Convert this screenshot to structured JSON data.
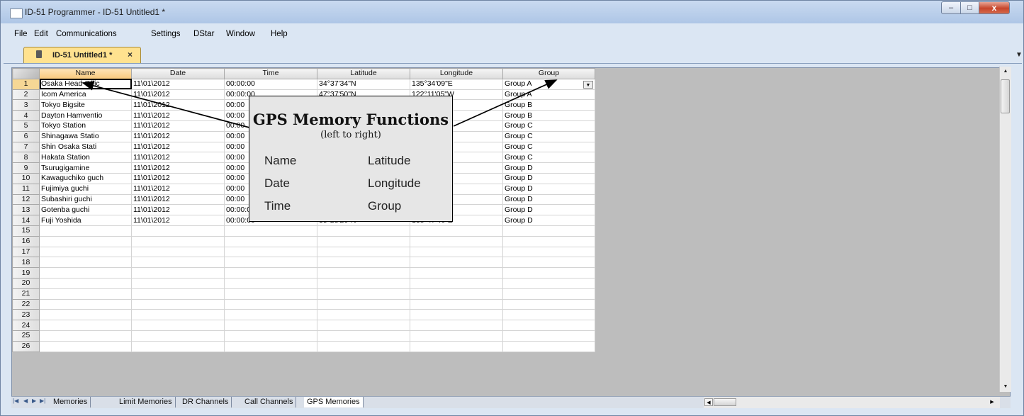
{
  "window": {
    "title": "ID-51 Programmer - ID-51 Untitled1 *",
    "controls": {
      "minimize": "‒",
      "maximize": "□",
      "close": "x"
    }
  },
  "menu": [
    "File",
    "Edit",
    "Communications",
    "Settings",
    "DStar",
    "Window",
    "Help"
  ],
  "document_tab": {
    "label": "ID-51 Untitled1 *",
    "close": "×",
    "icon": "radio-icon"
  },
  "grid": {
    "columns": [
      "Name",
      "Date",
      "Time",
      "Latitude",
      "Longitude",
      "Group"
    ],
    "rows": [
      {
        "num": "1",
        "name": "Osaka Head Offic",
        "date": "11\\01\\2012",
        "time": "00:00:00",
        "lat": "34°37'34\"N",
        "lon": "135°34'09\"E",
        "group": "Group A"
      },
      {
        "num": "2",
        "name": "Icom America",
        "date": "11\\01\\2012",
        "time": "00:00:00",
        "lat": "47°37'50\"N",
        "lon": "122°11'05\"W",
        "group": "Group A"
      },
      {
        "num": "3",
        "name": "Tokyo Bigsite",
        "date": "11\\01\\2012",
        "time": "00:00",
        "lat": "",
        "lon": "",
        "group": "Group B"
      },
      {
        "num": "4",
        "name": "Dayton Hamventio",
        "date": "11\\01\\2012",
        "time": "00:00",
        "lat": "",
        "lon": "",
        "group": "Group B"
      },
      {
        "num": "5",
        "name": "Tokyo Station",
        "date": "11\\01\\2012",
        "time": "00:00",
        "lat": "",
        "lon": "",
        "group": "Group C"
      },
      {
        "num": "6",
        "name": "Shinagawa Statio",
        "date": "11\\01\\2012",
        "time": "00:00",
        "lat": "",
        "lon": "",
        "group": "Group C"
      },
      {
        "num": "7",
        "name": "Shin Osaka Stati",
        "date": "11\\01\\2012",
        "time": "00:00",
        "lat": "",
        "lon": "",
        "group": "Group C"
      },
      {
        "num": "8",
        "name": "Hakata Station",
        "date": "11\\01\\2012",
        "time": "00:00",
        "lat": "",
        "lon": "",
        "group": "Group C"
      },
      {
        "num": "9",
        "name": "Tsurugigamine",
        "date": "11\\01\\2012",
        "time": "00:00",
        "lat": "",
        "lon": "",
        "group": "Group D"
      },
      {
        "num": "10",
        "name": "Kawaguchiko guch",
        "date": "11\\01\\2012",
        "time": "00:00",
        "lat": "",
        "lon": "",
        "group": "Group D"
      },
      {
        "num": "11",
        "name": "Fujimiya guchi",
        "date": "11\\01\\2012",
        "time": "00:00",
        "lat": "",
        "lon": "",
        "group": "Group D"
      },
      {
        "num": "12",
        "name": "Subashiri guchi",
        "date": "11\\01\\2012",
        "time": "00:00",
        "lat": "",
        "lon": "",
        "group": "Group D"
      },
      {
        "num": "13",
        "name": "Gotenba guchi",
        "date": "11\\01\\2012",
        "time": "00:00:00",
        "lat": "35°20'10\"N",
        "lon": "138°47'41\"E",
        "group": "Group D"
      },
      {
        "num": "14",
        "name": "Fuji Yoshida",
        "date": "11\\01\\2012",
        "time": "00:00:00",
        "lat": "35°28'20\"N",
        "lon": "138°47'46\"E",
        "group": "Group D"
      },
      {
        "num": "15",
        "name": "",
        "date": "",
        "time": "",
        "lat": "",
        "lon": "",
        "group": ""
      },
      {
        "num": "16",
        "name": "",
        "date": "",
        "time": "",
        "lat": "",
        "lon": "",
        "group": ""
      },
      {
        "num": "17",
        "name": "",
        "date": "",
        "time": "",
        "lat": "",
        "lon": "",
        "group": ""
      },
      {
        "num": "18",
        "name": "",
        "date": "",
        "time": "",
        "lat": "",
        "lon": "",
        "group": ""
      },
      {
        "num": "19",
        "name": "",
        "date": "",
        "time": "",
        "lat": "",
        "lon": "",
        "group": ""
      },
      {
        "num": "20",
        "name": "",
        "date": "",
        "time": "",
        "lat": "",
        "lon": "",
        "group": ""
      },
      {
        "num": "21",
        "name": "",
        "date": "",
        "time": "",
        "lat": "",
        "lon": "",
        "group": ""
      },
      {
        "num": "22",
        "name": "",
        "date": "",
        "time": "",
        "lat": "",
        "lon": "",
        "group": ""
      },
      {
        "num": "23",
        "name": "",
        "date": "",
        "time": "",
        "lat": "",
        "lon": "",
        "group": ""
      },
      {
        "num": "24",
        "name": "",
        "date": "",
        "time": "",
        "lat": "",
        "lon": "",
        "group": ""
      },
      {
        "num": "25",
        "name": "",
        "date": "",
        "time": "",
        "lat": "",
        "lon": "",
        "group": ""
      },
      {
        "num": "26",
        "name": "",
        "date": "",
        "time": "",
        "lat": "",
        "lon": "",
        "group": ""
      }
    ]
  },
  "sheet_tabs": [
    "Memories",
    "Limit Memories",
    "DR Channels",
    "Call Channels",
    "GPS Memories"
  ],
  "active_sheet": "GPS Memories",
  "callout": {
    "title": "GPS Memory Functions",
    "subtitle": "(left to right)",
    "left_items": [
      "Name",
      "Date",
      "Time"
    ],
    "right_items": [
      "Latitude",
      "Longitude",
      "Group"
    ]
  },
  "colors": {
    "active_tab": "#ffe28f",
    "header_selected": "#f8c97b",
    "background": "#bdbdbd"
  }
}
